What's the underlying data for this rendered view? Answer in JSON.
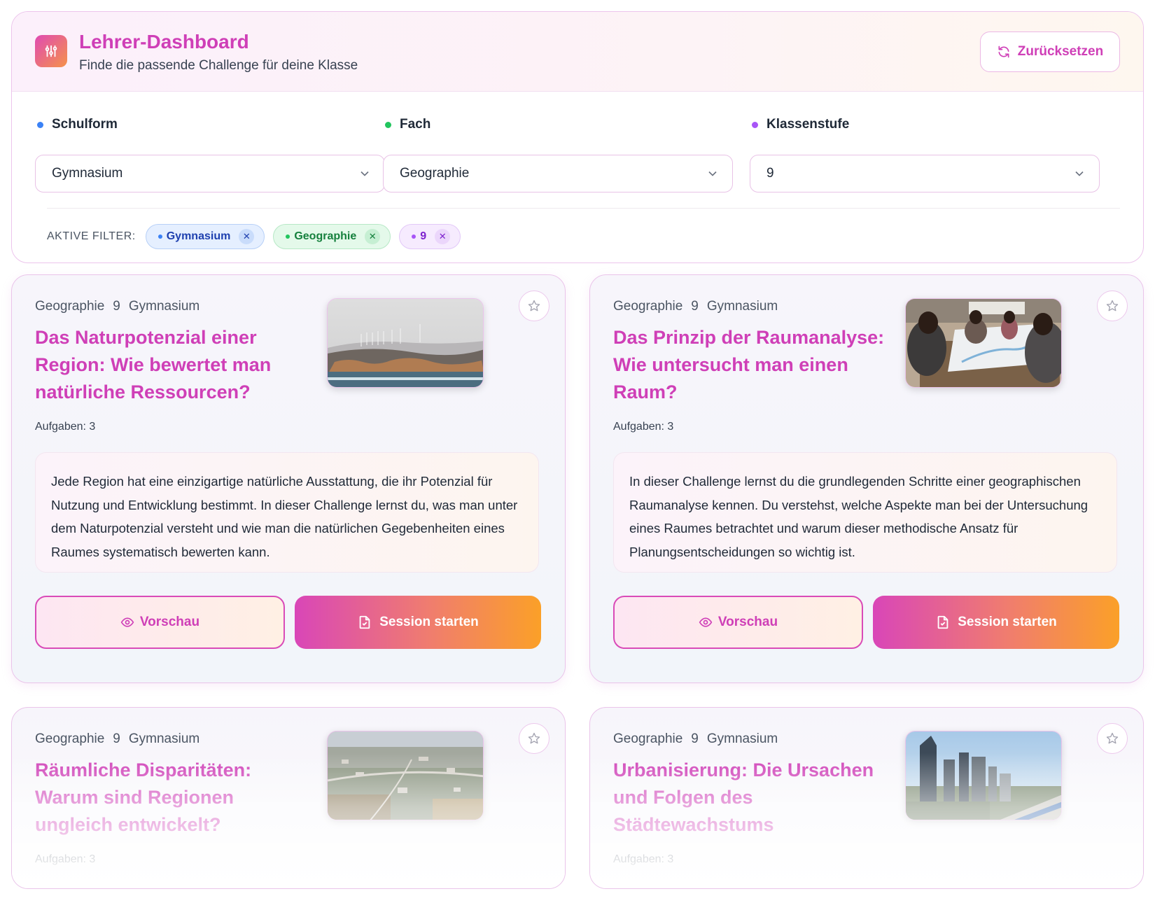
{
  "header": {
    "title": "Lehrer-Dashboard",
    "subtitle": "Finde die passende Challenge für deine Klasse",
    "reset_label": "Zurücksetzen"
  },
  "filters": [
    {
      "label": "Schulform",
      "value": "Gymnasium",
      "color": "#3b82f6"
    },
    {
      "label": "Fach",
      "value": "Geographie",
      "color": "#22c55e"
    },
    {
      "label": "Klassenstufe",
      "value": "9",
      "color": "#a855f7"
    }
  ],
  "active_filters": {
    "label": "AKTIVE FILTER:",
    "chips": [
      "Gymnasium",
      "Geographie",
      "9"
    ]
  },
  "cards": [
    {
      "subject": "Geographie",
      "grade": "9",
      "school": "Gymnasium",
      "title": "Das Naturpotenzial einer Region: Wie bewertet man natürliche Ressourcen?",
      "tasks": "Aufgaben: 3",
      "description": "Jede Region hat eine einzigartige natürliche Ausstattung, die ihr Potenzial für Nutzung und Entwicklung bestimmt. In dieser Challenge lernst du, was man unter dem Naturpotenzial versteht und wie man die natürlichen Gegebenheiten eines Raumes systematisch bewerten kann.",
      "preview_label": "Vorschau",
      "start_label": "Session starten",
      "image": "wind-farm-landscape"
    },
    {
      "subject": "Geographie",
      "grade": "9",
      "school": "Gymnasium",
      "title": "Das Prinzip der Raumanalyse: Wie untersucht man einen Raum?",
      "tasks": "Aufgaben: 3",
      "description": "In dieser Challenge lernst du die grundlegenden Schritte einer geographischen Raumanalyse kennen. Du verstehst, welche Aspekte man bei der Untersuchung eines Raumes betrachtet und warum dieser methodische Ansatz für Planungsentscheidungen so wichtig ist.",
      "preview_label": "Vorschau",
      "start_label": "Session starten",
      "image": "students-studying-map"
    },
    {
      "subject": "Geographie",
      "grade": "9",
      "school": "Gymnasium",
      "title": "Räumliche Disparitäten: Warum sind Regionen ungleich entwickelt?",
      "tasks": "Aufgaben: 3",
      "image": "aerial-town-view"
    },
    {
      "subject": "Geographie",
      "grade": "9",
      "school": "Gymnasium",
      "title": "Urbanisierung: Die Ursachen und Folgen des Städtewachstums",
      "tasks": "Aufgaben: 3",
      "image": "city-skyline"
    }
  ]
}
